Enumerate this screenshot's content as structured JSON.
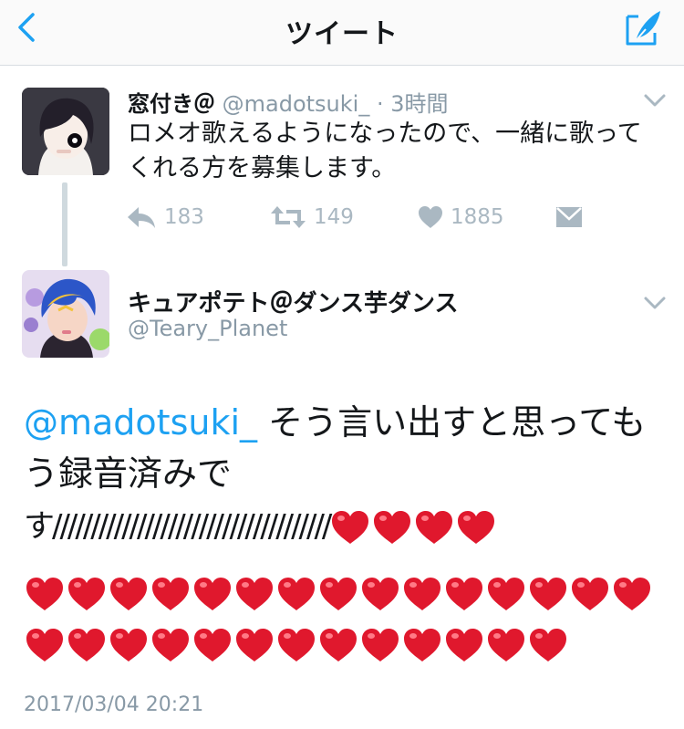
{
  "nav": {
    "title": "ツイート"
  },
  "tweet1": {
    "display_name": "窓付き＠",
    "handle": "@madotsuki_",
    "separator": " · ",
    "time": "3時間",
    "text_line1": "ロメオ歌えるようになったので、一緒に歌って",
    "text_line2": "くれる方を募集します。",
    "reply_count": "183",
    "retweet_count": "149",
    "like_count": "1885"
  },
  "tweet2": {
    "display_name": "キュアポテト＠ダンス芋ダンス",
    "handle": "@Teary_Planet",
    "mention": "@madotsuki_",
    "text_line1": " そう言い出すと思っても",
    "text_line2": "う録音済みで",
    "text_line3": "す////////////////////////////////////",
    "hearts_row1": 4,
    "hearts_row2": 15,
    "hearts_row3": 13,
    "timestamp": "2017/03/04 20:21"
  },
  "colors": {
    "accent": "#1da1f2",
    "muted": "#8899a6",
    "heart": "#e0182d"
  }
}
